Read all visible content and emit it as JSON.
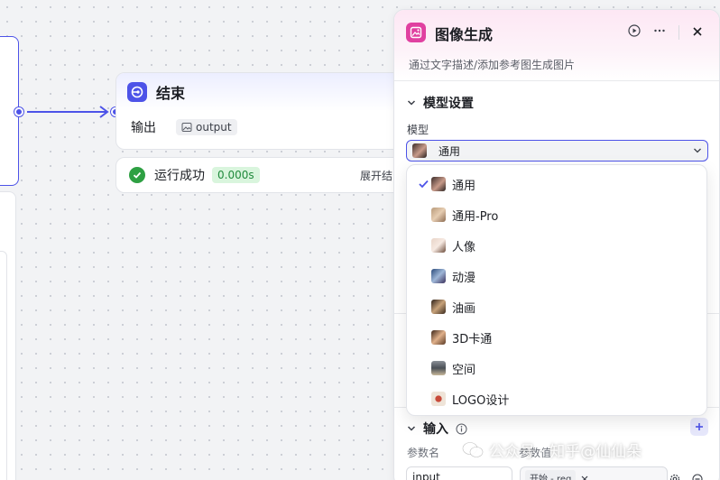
{
  "canvas": {
    "end_node": {
      "title": "结束",
      "output_label": "输出",
      "output_variable": "output"
    },
    "run_status": {
      "text": "运行成功",
      "time": "0.000s",
      "expand_label": "展开结"
    }
  },
  "panel": {
    "title": "图像生成",
    "description": "通过文字描述/添加参考图生成图片",
    "model_section": {
      "title": "模型设置",
      "model_label": "模型",
      "selected": "通用",
      "options": [
        {
          "label": "通用",
          "selected": true
        },
        {
          "label": "通用-Pro",
          "selected": false
        },
        {
          "label": "人像",
          "selected": false
        },
        {
          "label": "动漫",
          "selected": false
        },
        {
          "label": "油画",
          "selected": false
        },
        {
          "label": "3D卡通",
          "selected": false
        },
        {
          "label": "空间",
          "selected": false
        },
        {
          "label": "LOGO设计",
          "selected": false
        }
      ]
    },
    "input_section": {
      "title": "输入",
      "param_name_header": "参数名",
      "param_value_header": "参数值",
      "param_name_value": "input",
      "param_ref": "开始 - req"
    }
  },
  "watermark": "公众号 · 知乎@仙仙朵",
  "colors": {
    "accent": "#4d53e8",
    "success": "#2ea043",
    "panel_icon": "#e040a0"
  }
}
